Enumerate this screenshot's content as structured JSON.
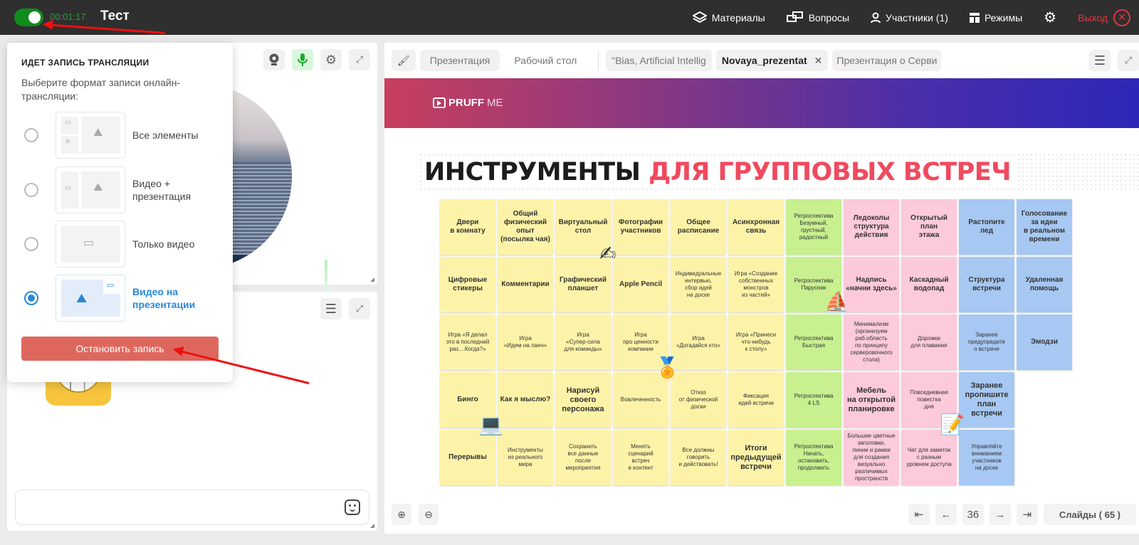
{
  "topbar": {
    "recording_on": true,
    "timer": "00:01:17",
    "title": "Тест",
    "nav": [
      {
        "icon": "layers-icon",
        "label": "Материалы"
      },
      {
        "icon": "chat-bubbles-icon",
        "label": "Вопросы"
      },
      {
        "icon": "user-icon",
        "label": "Участники (1)"
      },
      {
        "icon": "layout-icon",
        "label": "Режимы"
      }
    ],
    "exit_label": "Выход",
    "accent_green": "#118a1e",
    "exit_color": "#e0393e"
  },
  "video": {
    "tools": [
      "webcam-icon",
      "microphone-icon",
      "gear-icon",
      "expand-icon"
    ]
  },
  "recording_popup": {
    "heading": "ИДЕТ ЗАПИСЬ ТРАНСЛЯЦИИ",
    "description": "Выберите формат записи онлайн-трансляции:",
    "options": [
      {
        "label": "Все элементы",
        "selected": false
      },
      {
        "label": "Видео + презентация",
        "selected": false
      },
      {
        "label": "Только видео",
        "selected": false
      },
      {
        "label": "Видео на презентации",
        "selected": true
      }
    ],
    "stop_button": "Остановить запись",
    "stop_color": "#de675d",
    "selected_color": "#2a88d8"
  },
  "chat": {
    "input_value": "",
    "input_placeholder": ""
  },
  "presentation": {
    "mode_tabs": [
      "Презентация",
      "Рабочий стол"
    ],
    "file_tabs": [
      {
        "label": "\"Bias, Artificial Intellig",
        "active": false
      },
      {
        "label": "Novaya_prezentat",
        "active": true,
        "closable": true
      },
      {
        "label": "Презентация о Серви",
        "active": false
      }
    ],
    "slide": {
      "logo": {
        "brand": "PRUFF",
        "suffix": "ME"
      },
      "headline_dark": "ИНСТРУМЕНТЫ",
      "headline_red": "ДЛЯ ГРУППОВЫХ ВСТРЕЧ",
      "cards": [
        [
          {
            "text": "Двери\nв комнату",
            "color": "y"
          },
          {
            "text": "Общий\nфизический\nопыт\n(посылка чая)",
            "color": "y"
          },
          {
            "text": "Виртуальный\nстол",
            "color": "y"
          },
          {
            "text": "Фотографии\nучастников",
            "color": "y"
          },
          {
            "text": "Общее\nрасписание",
            "color": "y"
          },
          {
            "text": "Асинхронная\nсвязь",
            "color": "y"
          },
          {
            "text": "Ретроспектива\nБезумный,\nгрустный,\nрадостный",
            "color": "g",
            "size": "sm"
          },
          {
            "text": "Ледоколы\nструктура\nдействия",
            "color": "p"
          },
          {
            "text": "Открытый\nплан\nэтажа",
            "color": "p"
          },
          {
            "text": "Растопите\nлед",
            "color": "b"
          },
          {
            "text": "Голосование\nза идеи\nв реальном\nвремени",
            "color": "b"
          }
        ],
        [
          {
            "text": "Цифровые\nстикеры",
            "color": "y"
          },
          {
            "text": "Комментарии",
            "color": "y"
          },
          {
            "text": "Графический\nпланшет",
            "color": "y"
          },
          {
            "text": "Apple Pencil",
            "color": "y"
          },
          {
            "text": "Индивидуальные\nинтервью,\nсбор идей\nна доске",
            "color": "y",
            "size": "sm"
          },
          {
            "text": "Игра «Создание\nсобственных\nмонстров\nиз частей»",
            "color": "y",
            "size": "sm"
          },
          {
            "text": "Ретроспектива\nПарусник",
            "color": "g",
            "size": "sm"
          },
          {
            "text": "Надпись\n«начни здесь»",
            "color": "p"
          },
          {
            "text": "Каскадный\nводопад",
            "color": "p"
          },
          {
            "text": "Структура\nвстречи",
            "color": "b"
          },
          {
            "text": "Удаленная\nпомощь",
            "color": "b"
          }
        ],
        [
          {
            "text": "Игра «Я делал\nэто в последний\nраз....Когда?»",
            "color": "y",
            "size": "sm"
          },
          {
            "text": "Игра\n«Идем на ланч»",
            "color": "y",
            "size": "sm"
          },
          {
            "text": "Игра\n«Супер-сила\nдля команды»",
            "color": "y",
            "size": "sm"
          },
          {
            "text": "Игра\nпро ценности\nкомпании",
            "color": "y",
            "size": "sm"
          },
          {
            "text": "Игра\n«Догадайся кто»",
            "color": "y",
            "size": "sm"
          },
          {
            "text": "Игра «Принеси\nчто-нибудь\nк столу»",
            "color": "y",
            "size": "sm"
          },
          {
            "text": "Ретроспектива\nБыстрая",
            "color": "g",
            "size": "sm"
          },
          {
            "text": "Минимализм\n(организуем\nраб.область\nпо принципу\nсерверовочного\nстола)",
            "color": "p",
            "size": "sm"
          },
          {
            "text": "Дорожки\nдля плавания",
            "color": "p",
            "size": "sm"
          },
          {
            "text": "Заранее\nпредупредите\nо встрече",
            "color": "b",
            "size": "sm"
          },
          {
            "text": "Эмодзи",
            "color": "b"
          }
        ],
        [
          {
            "text": "Бинго",
            "color": "y"
          },
          {
            "text": "Как я мыслю?",
            "color": "y"
          },
          {
            "text": "Нарисуй\nсвоего\nперсонажа",
            "color": "y",
            "size": "lg"
          },
          {
            "text": "Вовлеченность",
            "color": "y",
            "size": "sm"
          },
          {
            "text": "Отказ\nот физической\nдоски",
            "color": "y",
            "size": "sm"
          },
          {
            "text": "Фиксация\nидей встречи",
            "color": "y",
            "size": "sm"
          },
          {
            "text": "Ретроспектива\n4 LS",
            "color": "g",
            "size": "sm"
          },
          {
            "text": "Мебель\nна открытой\nпланировке",
            "color": "p",
            "size": "lg"
          },
          {
            "text": "Повседневная\nповестка\nдня",
            "color": "p",
            "size": "sm"
          },
          {
            "text": "Заранее\nпропишите\nплан\nвстречи",
            "color": "b",
            "size": "lg"
          }
        ],
        [
          {
            "text": "Перерывы",
            "color": "y"
          },
          {
            "text": "Инструменты\nиз реального\nмира",
            "color": "y",
            "size": "sm"
          },
          {
            "text": "Сохранить\nвсе данные\nпосле\nмероприятия",
            "color": "y",
            "size": "sm"
          },
          {
            "text": "Менять\nсценарий\nвстреч\nи контент",
            "color": "y",
            "size": "sm"
          },
          {
            "text": "Все должны\nговорить\nи действовать!",
            "color": "y",
            "size": "sm"
          },
          {
            "text": "Итоги\nпредыдущей\nвстречи",
            "color": "y",
            "size": "lg"
          },
          {
            "text": "Ретроспектива\nНачать,\nостановить,\nпродолжить",
            "color": "g",
            "size": "sm"
          },
          {
            "text": "Большие цветные\nзаголовки,\nлинии и рамки\nдля создания\nвизуально\nразличимых\nпространств",
            "color": "p",
            "size": "sm"
          },
          {
            "text": "Чат для заметок\nс разным\nуровнем доступа",
            "color": "p",
            "size": "sm"
          },
          {
            "text": "Управляйте\nвниманием\nучастников\nна доске",
            "color": "b",
            "size": "sm"
          }
        ]
      ]
    },
    "pager": {
      "current_page": "36",
      "slides_label": "Слайды ( 65 )"
    }
  }
}
